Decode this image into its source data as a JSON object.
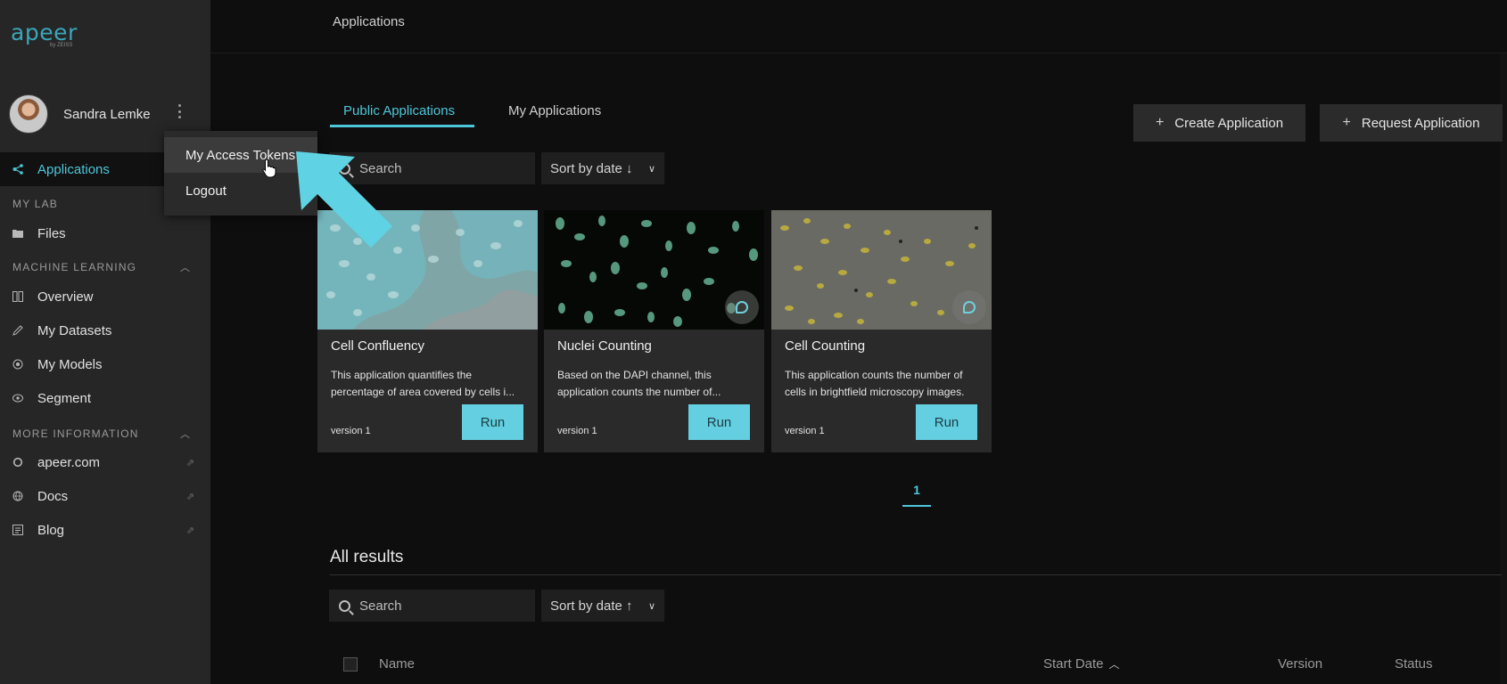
{
  "brand": {
    "name": "apeer",
    "sub": "by ZEISS"
  },
  "user": {
    "name": "Sandra Lemke"
  },
  "user_menu": {
    "items": [
      "My Access Tokens",
      "Logout"
    ]
  },
  "sidebar": {
    "applications": "Applications",
    "my_lab": {
      "title": "MY LAB",
      "items": [
        "Files"
      ]
    },
    "machine_learning": {
      "title": "MACHINE LEARNING",
      "items": [
        "Overview",
        "My Datasets",
        "My Models",
        "Segment"
      ]
    },
    "more_information": {
      "title": "MORE INFORMATION",
      "items": [
        "apeer.com",
        "Docs",
        "Blog"
      ]
    }
  },
  "header": {
    "title": "Applications"
  },
  "tabs": [
    "Public Applications",
    "My Applications"
  ],
  "actions": {
    "create": "Create Application",
    "request": "Request Application"
  },
  "filters": {
    "search_placeholder": "Search",
    "sort_top": "Sort by date ↓",
    "sort_bottom": "Sort by date ↑"
  },
  "cards": [
    {
      "title": "Cell Confluency",
      "description": "This application quantifies the percentage of area covered by cells i...",
      "version": "version 1",
      "run": "Run"
    },
    {
      "title": "Nuclei Counting",
      "description": "Based on the DAPI channel, this application counts the number of...",
      "version": "version 1",
      "run": "Run"
    },
    {
      "title": "Cell Counting",
      "description": "This application counts the number of cells in brightfield microscopy images.",
      "version": "version 1",
      "run": "Run"
    }
  ],
  "pagination": {
    "current": "1"
  },
  "results": {
    "title": "All results",
    "columns": {
      "name": "Name",
      "start_date": "Start Date",
      "version": "Version",
      "status": "Status"
    }
  },
  "colors": {
    "accent": "#4ec6d9",
    "run_button": "#63cfe0",
    "sidebar_bg": "#262626",
    "page_bg": "#0e0e0e"
  }
}
